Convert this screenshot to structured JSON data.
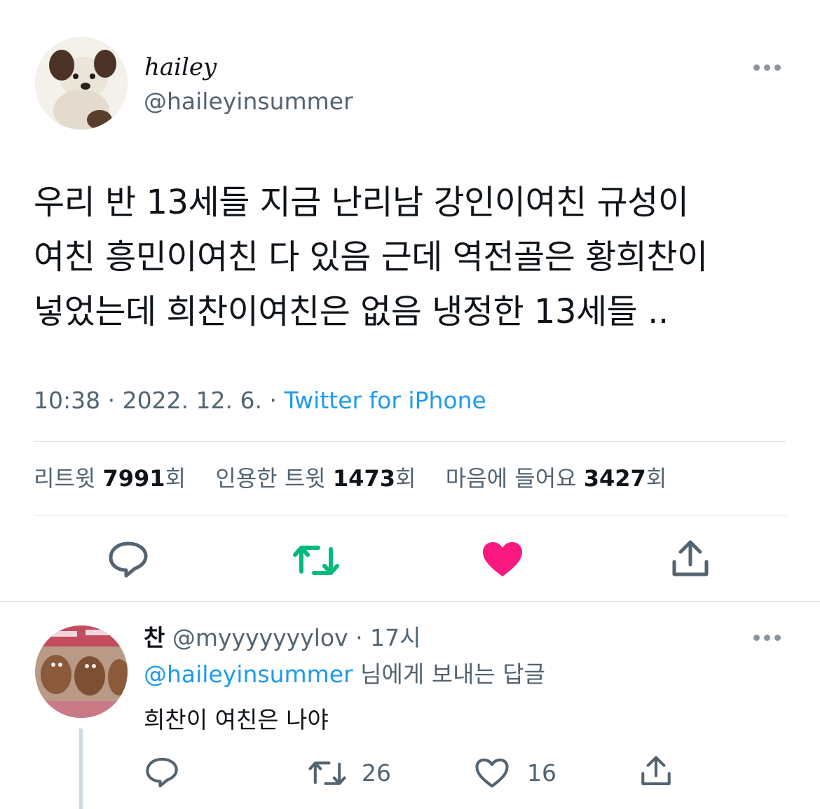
{
  "tweet": {
    "display_name": "hailey",
    "handle": "@haileyinsummer",
    "text_lines": [
      "우리 반 13세들 지금 난리남 강인이여친 규성이",
      "여친 흥민이여친 다 있음 근데 역전골은 황희찬이",
      "넣었는데 희찬이여친은 없음 냉정한 13세들 .."
    ],
    "meta": {
      "time_date": "10:38 · 2022. 12. 6. · ",
      "source": "Twitter for iPhone"
    },
    "stats": {
      "retweets_label": "리트윗 ",
      "retweets_count": "7991",
      "retweets_unit": "회",
      "quotes_label": "인용한 트윗 ",
      "quotes_count": "1473",
      "quotes_unit": "회",
      "likes_label": "마음에 들어요 ",
      "likes_count": "3427",
      "likes_unit": "회"
    },
    "actions": {
      "reply_icon": "reply-icon",
      "retweet_icon": "retweet-icon",
      "like_icon": "heart-filled-icon",
      "share_icon": "share-icon"
    }
  },
  "reply": {
    "display_name": "찬",
    "handle_time": "@myyyyyyylov · 17시",
    "replying_to_handle": "@haileyinsummer",
    "replying_to_suffix": " 님에게 보내는 답글",
    "text": "희찬이 여친은 나야",
    "retweet_count": "26",
    "like_count": "16"
  },
  "colors": {
    "accent_blue": "#1d9bf0",
    "retweet_green": "#00ba7c",
    "like_pink": "#f91880",
    "muted": "#536471"
  }
}
